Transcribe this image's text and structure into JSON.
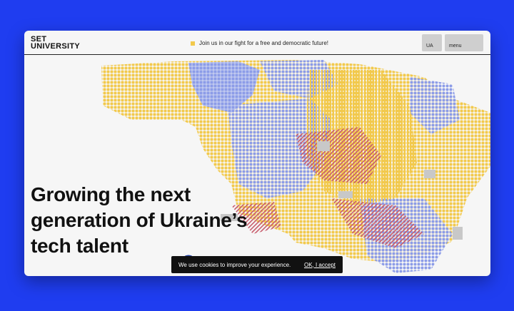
{
  "brand": {
    "line1": "SET",
    "line2": "UNIVERSITY"
  },
  "banner": {
    "text": "Join us in our fight for a free and democratic future!"
  },
  "nav": {
    "lang_label": "UA",
    "menu_label": "menu"
  },
  "hero": {
    "lines": [
      "Growing the next",
      "generation of Ukraine’s",
      "tech talent"
    ]
  },
  "cookie": {
    "text": "We use cookies to improve your experience.",
    "accept_label": "OK, I accept"
  },
  "colors": {
    "background": "#1f3df0",
    "yellow": "#f2c94c",
    "blue": "#8c9ce8",
    "red": "#c75b6b",
    "grey": "#c8c8c8"
  }
}
